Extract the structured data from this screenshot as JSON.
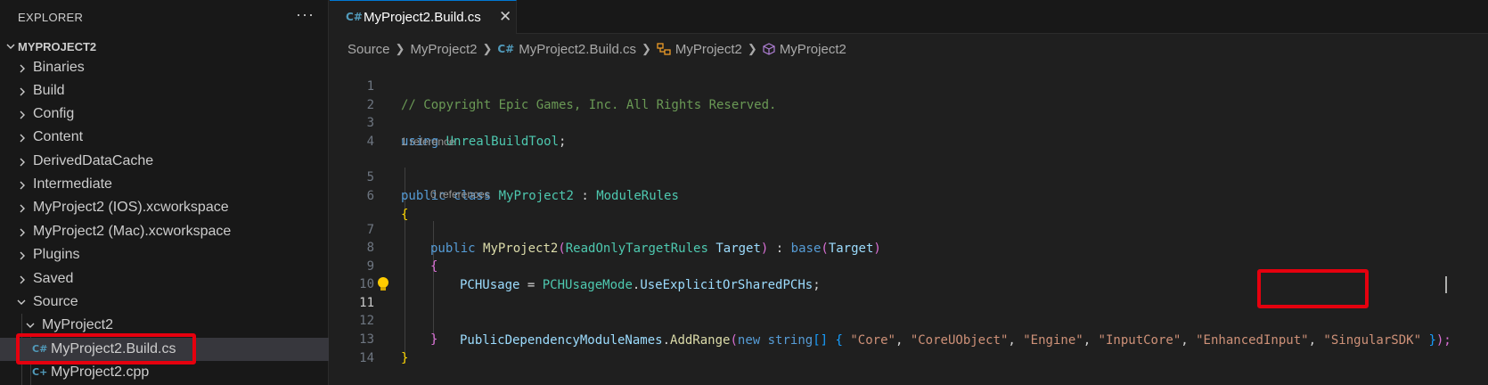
{
  "sidebar": {
    "title": "EXPLORER",
    "more_label": "···",
    "project_name": "MYPROJECT2",
    "tree": {
      "binaries": "Binaries",
      "build": "Build",
      "config": "Config",
      "content": "Content",
      "derived": "DerivedDataCache",
      "intermediate": "Intermediate",
      "ios_ws": "MyProject2 (IOS).xcworkspace",
      "mac_ws": "MyProject2 (Mac).xcworkspace",
      "plugins": "Plugins",
      "saved": "Saved",
      "source": "Source",
      "myproject2": "MyProject2",
      "build_cs": "MyProject2.Build.cs",
      "cpp": "MyProject2.cpp"
    },
    "csharp_icon": "C#",
    "cpp_icon": "C+"
  },
  "editor": {
    "tab": {
      "label": "MyProject2.Build.cs",
      "close": "✕",
      "icon": "C#"
    },
    "breadcrumb": [
      "Source",
      "MyProject2",
      "MyProject2.Build.cs",
      "MyProject2",
      "MyProject2"
    ],
    "codelens": {
      "class_refs": "1 reference",
      "ctor_refs": "0 references"
    },
    "line_numbers": [
      "1",
      "2",
      "3",
      "4",
      "5",
      "6",
      "7",
      "8",
      "9",
      "10",
      "11",
      "12",
      "13",
      "14"
    ],
    "code": {
      "l1": "// Copyright Epic Games, Inc. All Rights Reserved.",
      "l3_kw": "using",
      "l3_ns": "UnrealBuildTool",
      "l3_semi": ";",
      "l5_kw": "public class",
      "l5_name": "MyProject2",
      "l5_colon": " : ",
      "l5_base": "ModuleRules",
      "l6_brace": "{",
      "l7_kw": "public",
      "l7_name": "MyProject2",
      "l7_paren": "(",
      "l7_ptype": "ReadOnlyTargetRules",
      "l7_pname": "Target",
      "l7_close": ")",
      "l7_colon": " : ",
      "l7_base": "base",
      "l7_paren2": "(",
      "l7_arg": "Target",
      "l7_close2": ")",
      "l8_brace": "{",
      "l9_lhs": "PCHUsage",
      "l9_eq": " = ",
      "l9_type": "PCHUsageMode",
      "l9_dot": ".",
      "l9_val": "UseExplicitOrSharedPCHs",
      "l9_semi": ";",
      "l11_obj": "PublicDependencyModuleNames",
      "l11_dot": ".",
      "l11_fn": "AddRange",
      "l11_paren": "(",
      "l11_new": "new",
      "l11_string": "string",
      "l11_arr": "[]",
      "l11_open": "{",
      "l11_s1": "\"Core\"",
      "l11_s2": "\"CoreUObject\"",
      "l11_s3": "\"Engine\"",
      "l11_s4": "\"InputCore\"",
      "l11_s5": "\"EnhancedInput\"",
      "l11_s6": "\"SingularSDK\"",
      "l11_comma": ", ",
      "l11_closebrace": "}",
      "l11_end": ");",
      "l12_brace": "}",
      "l13_brace": "}"
    }
  },
  "colors": {
    "annotation": "#e5000e",
    "comment": "#6a9955",
    "keyword": "#569cd6",
    "type": "#4ec9b0",
    "string": "#ce9178"
  },
  "icons": [
    "ellipsis-icon",
    "chevron-right-icon",
    "chevron-down-icon",
    "csharp-file-icon",
    "cpp-file-icon",
    "close-icon",
    "class-icon",
    "method-icon",
    "lightbulb-icon"
  ]
}
